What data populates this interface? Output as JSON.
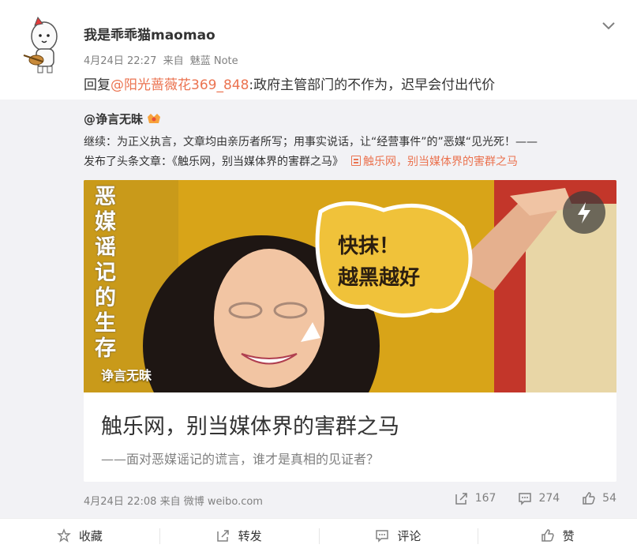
{
  "post": {
    "author": "我是乖乖猫maomao",
    "date": "4月24日 22:27",
    "from_prefix": "来自",
    "source": "魅蓝 Note",
    "reply_prefix": "回复",
    "reply_mention": "@阳光蔷薇花369_848",
    "reply_text": ":政府主管部门的不作为，迟早会付出代价"
  },
  "repost": {
    "author": "@诤言无昧",
    "text_line1": "继续：为正义执言，文章均由亲历者所写；用事实说话，让“经营事件”的”恶媒“见光死！——",
    "text_line2": "发布了头条文章：《触乐网，别当媒体界的害群之马》",
    "article_link": "触乐网，别当媒体界的害群之马",
    "card": {
      "image_vertical_text": "恶媒谣记的生存",
      "bubble_line1": "快抹！",
      "bubble_line2": "越黑越好",
      "source_label": "诤言无昧",
      "title": "触乐网，别当媒体界的害群之马",
      "subtitle": "——面对恶媒谣记的谎言，谁才是真相的见证者？"
    },
    "date": "4月24日 22:08",
    "from_prefix": "来自",
    "source": "微博 weibo.com",
    "stats": {
      "reposts": "167",
      "comments": "274",
      "likes": "54"
    }
  },
  "actions": {
    "favorite": "收藏",
    "repost": "转发",
    "comment": "评论",
    "like": "赞"
  },
  "colors": {
    "link": "#eb7350",
    "muted": "#808080",
    "repost_bg": "#f2f2f5"
  },
  "icons": [
    "cat-avatar-icon",
    "chevron-down-icon",
    "vip-badge-icon",
    "article-icon",
    "lightning-icon",
    "repost-icon",
    "comment-icon",
    "like-icon",
    "star-icon"
  ]
}
